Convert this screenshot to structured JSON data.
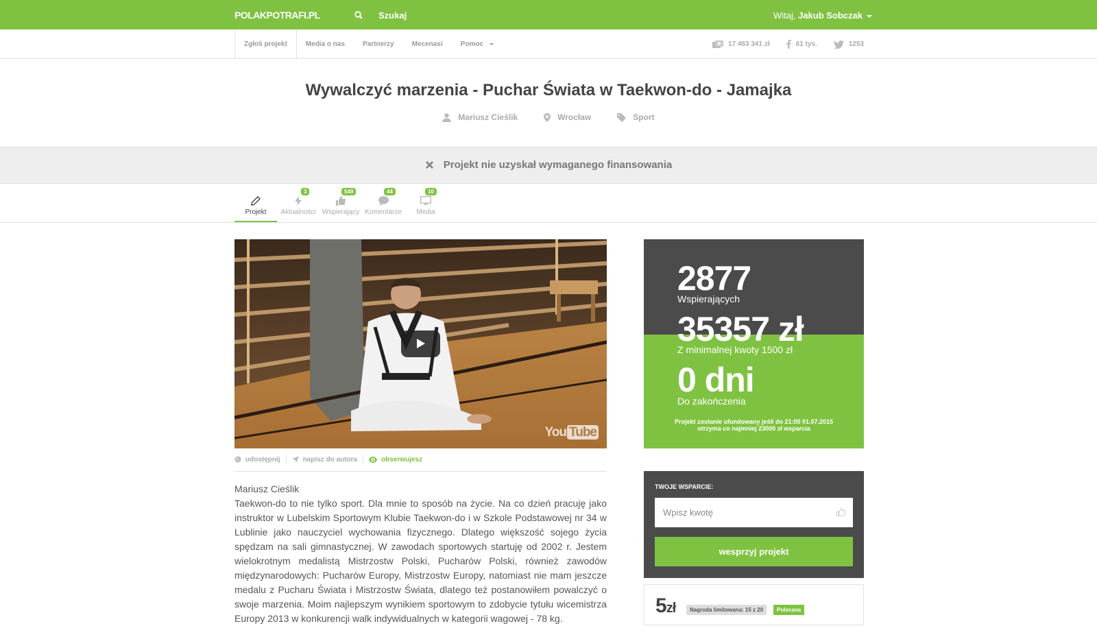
{
  "topbar": {
    "logo": "POLAKPOTRAFI.PL",
    "search_label": "Szukaj",
    "greeting_prefix": "Witaj,",
    "user_name": "Jakub Sobczak"
  },
  "subnav": {
    "items": [
      "Zgłoś projekt",
      "Media o nas",
      "Partnerzy",
      "Mecenasi",
      "Pomoc"
    ],
    "stats": {
      "total_funds": "17 463 341 zł",
      "facebook": "61 tys.",
      "twitter": "1253"
    }
  },
  "project": {
    "title": "Wywalczyć marzenia - Puchar Świata w Taekwon-do - Jamajka",
    "author": "Mariusz Cieślik",
    "location": "Wrocław",
    "category": "Sport",
    "status_message": "Projekt nie uzyskał wymaganego finansowania"
  },
  "tabs": [
    {
      "label": "Projekt",
      "badge": ""
    },
    {
      "label": "Aktualności",
      "badge": "3"
    },
    {
      "label": "Wspierający",
      "badge": "549"
    },
    {
      "label": "Komentarze",
      "badge": "44"
    },
    {
      "label": "Media",
      "badge": "10"
    }
  ],
  "video": {
    "provider": "YouTube",
    "provider_text": "You",
    "provider_box": "Tube"
  },
  "actions": {
    "share": "udostępnij",
    "message": "napisz do autora",
    "watch": "obserwujesz"
  },
  "description": {
    "author": "Mariusz Cieślik",
    "text": "Taekwon-do to nie tylko sport. Dla mnie to sposób na życie. Na co dzień pracuję jako instruktor w Lubelskim Sportowym Klubie Taekwon-do i w Szkole Podstawowej nr 34 w Lublinie jako nauczyciel wychowania fizycznego. Dlatego większość sojego życia spędzam na sali gimnastycznej. W zawodach sportowych startuję od 2002 r. Jestem wielokrotnym medalistą Mistrzostw Polski, Pucharów Polski, również zawodów międzynarodowych: Pucharów Europy, Mistrzostw Europy, natomiast nie mam jeszcze medalu z Pucharu Świata i Mistrzostw Świata, dlatego też postanowiłem powalczyć o swoje marzenia. Moim najlepszym wynikiem sportowym to zdobycie tytułu wicemistrza Europy 2013 w konkurencji walk indywidualnych w kategorii wagowej - 78 kg."
  },
  "funding": {
    "supporters_count": "2877",
    "supporters_label": "Wspierających",
    "amount": "35357 zł",
    "amount_label": "Z minimalnej kwoty 1500 zł",
    "days": "0 dni",
    "days_label": "Do zakończenia",
    "note_line1": "Projekt zostanie ufundowany jeśli do 21:00 01.07.2015",
    "note_line2": "otrzyma co najmniej 23000 zł wsparcia"
  },
  "support": {
    "title": "TWOJE WSPARCIE:",
    "placeholder": "Wpisz kwotę",
    "button": "wesprzyj projekt"
  },
  "reward": {
    "price_value": "5",
    "price_currency": "zł",
    "limit": "Nagroda limitowana: 15 z 20",
    "recommended": "Polecana"
  },
  "colors": {
    "brand_green": "#7fc241",
    "dark_panel": "#4b4b4b"
  }
}
